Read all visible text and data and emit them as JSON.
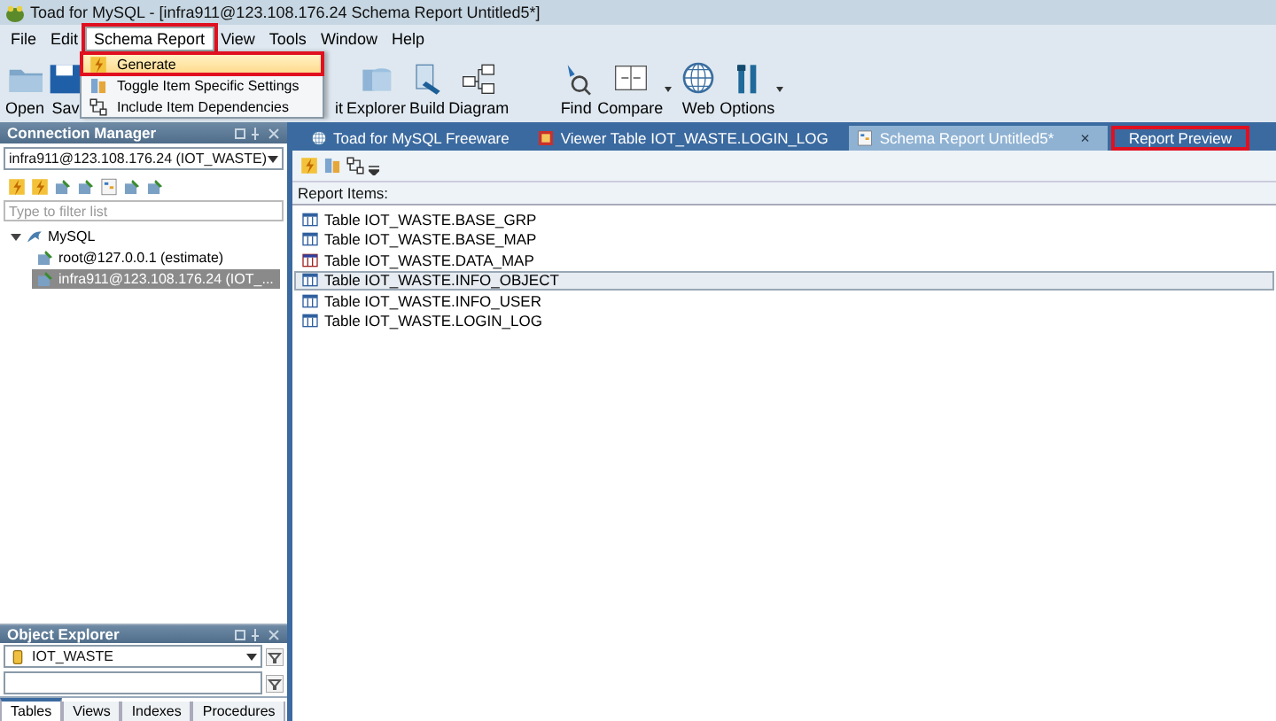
{
  "window": {
    "title": "Toad for MySQL - [infra911@123.108.176.24 Schema Report Untitled5*]"
  },
  "menu": [
    {
      "label": "File",
      "open": false,
      "highlighted": false
    },
    {
      "label": "Edit",
      "open": false,
      "highlighted": false
    },
    {
      "label": "Schema Report",
      "open": true,
      "highlighted": true
    },
    {
      "label": "View",
      "open": false,
      "highlighted": false
    },
    {
      "label": "Tools",
      "open": false,
      "highlighted": false
    },
    {
      "label": "Window",
      "open": false,
      "highlighted": false
    },
    {
      "label": "Help",
      "open": false,
      "highlighted": false
    }
  ],
  "dropdown": [
    {
      "label": "Generate",
      "kind": "generate",
      "hovered": true,
      "highlighted": true
    },
    {
      "label": "Toggle Item Specific Settings",
      "kind": "toggle",
      "hovered": false,
      "highlighted": false
    },
    {
      "label": "Include Item Dependencies",
      "kind": "dependencies",
      "hovered": false,
      "highlighted": false
    }
  ],
  "toolbar": [
    {
      "label": "Open",
      "kind": "folder",
      "dropdown": false
    },
    {
      "label": "Sav",
      "kind": "disk",
      "dropdown": false
    },
    {
      "label": "it",
      "kind": "hidden",
      "dropdown": false
    },
    {
      "label": "Explorer",
      "kind": "explorer",
      "dropdown": false
    },
    {
      "label": "Build",
      "kind": "build",
      "dropdown": false
    },
    {
      "label": "Diagram",
      "kind": "diagram",
      "dropdown": false
    },
    {
      "label": "Find",
      "kind": "find",
      "dropdown": false
    },
    {
      "label": "Compare",
      "kind": "compare",
      "dropdown": true
    },
    {
      "label": "Web",
      "kind": "globe",
      "dropdown": false
    },
    {
      "label": "Options",
      "kind": "tools",
      "dropdown": true
    }
  ],
  "connection_manager": {
    "title": "Connection Manager",
    "connection": "infra911@123.108.176.24 (IOT_WASTE)",
    "filter": {
      "placeholder": "Type to filter list"
    },
    "tree": [
      {
        "label": "MySQL",
        "expanded": true,
        "selected": false,
        "children": [
          {
            "label": "root@127.0.0.1 (estimate)",
            "selected": false
          },
          {
            "label": "infra911@123.108.176.24 (IOT_...",
            "selected": true
          }
        ]
      }
    ]
  },
  "tabs": [
    {
      "label": "Toad for MySQL Freeware",
      "kind": "globe",
      "selected": false,
      "highlighted": false
    },
    {
      "label": "Viewer Table IOT_WASTE.LOGIN_LOG",
      "kind": "viewer",
      "selected": false,
      "highlighted": false
    },
    {
      "label": "Schema Report Untitled5*",
      "kind": "report",
      "selected": true,
      "highlighted": false,
      "close": "×"
    },
    {
      "label": "Report Preview",
      "kind": "none",
      "selected": false,
      "highlighted": true
    }
  ],
  "report": {
    "label": "Report Items:",
    "items": [
      {
        "label": "Table IOT_WASTE.BASE_GRP",
        "kind": "table",
        "selected": false
      },
      {
        "label": "Table IOT_WASTE.BASE_MAP",
        "kind": "table",
        "selected": false
      },
      {
        "label": "Table IOT_WASTE.DATA_MAP",
        "kind": "data",
        "selected": false
      },
      {
        "label": "Table IOT_WASTE.INFO_OBJECT",
        "kind": "table",
        "selected": true
      },
      {
        "label": "Table IOT_WASTE.INFO_USER",
        "kind": "table",
        "selected": false
      },
      {
        "label": "Table IOT_WASTE.LOGIN_LOG",
        "kind": "table",
        "selected": false
      }
    ]
  },
  "object_explorer": {
    "title": "Object Explorer",
    "database": "IOT_WASTE",
    "tabs": [
      {
        "label": "Tables",
        "selected": true
      },
      {
        "label": "Views",
        "selected": false
      },
      {
        "label": "Indexes",
        "selected": false
      },
      {
        "label": "Procedures",
        "selected": false
      }
    ]
  }
}
